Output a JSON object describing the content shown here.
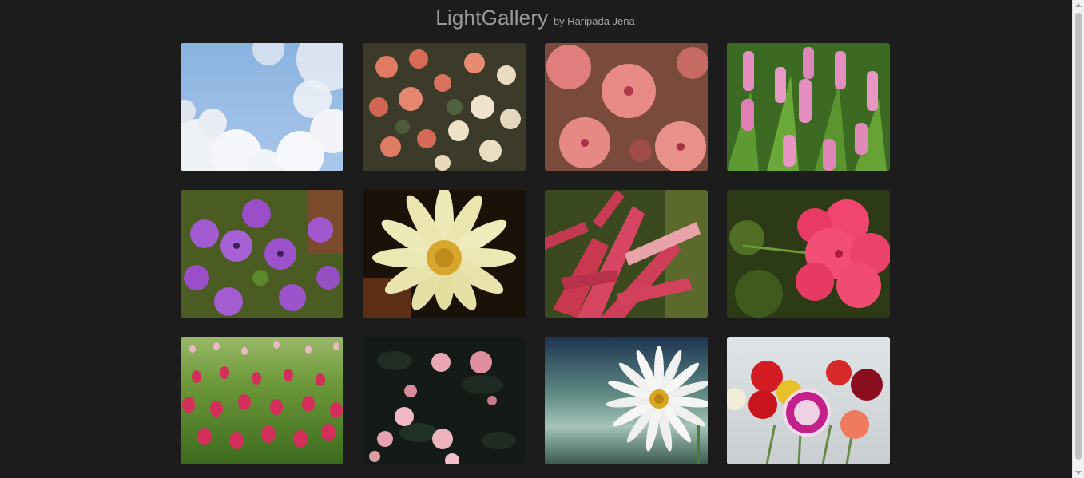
{
  "header": {
    "title": "LightGallery",
    "byline": "by Haripada Jena"
  },
  "gallery": {
    "items": [
      {
        "subject": "frosted trees against blue sky"
      },
      {
        "subject": "begonia flowers"
      },
      {
        "subject": "pink hibiscus flowers"
      },
      {
        "subject": "pink curcuma flowers"
      },
      {
        "subject": "purple violets"
      },
      {
        "subject": "pale yellow daisy"
      },
      {
        "subject": "red bromeliad"
      },
      {
        "subject": "pink geranium"
      },
      {
        "subject": "tulip field"
      },
      {
        "subject": "pink camellias on dark leaves"
      },
      {
        "subject": "white daisy"
      },
      {
        "subject": "carnations bouquet"
      }
    ]
  },
  "colors": {
    "background": "#1c1c1c",
    "title": "#9a9a9a"
  }
}
